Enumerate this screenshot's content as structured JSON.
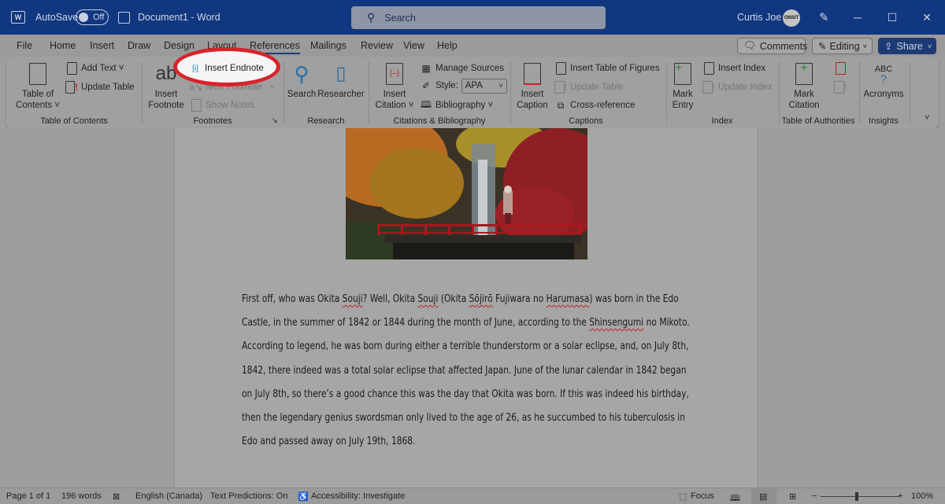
{
  "titlebar": {
    "app_icon": "word-icon",
    "autosave_label": "AutoSave",
    "autosave_state": "Off",
    "doc_title": "Document1  -  Word",
    "search_placeholder": "Search",
    "user_name": "Curtis Joe",
    "avatar_text": "ONSIT",
    "minimize": "─",
    "maximize": "☐",
    "close": "✕"
  },
  "tabs": [
    "File",
    "Home",
    "Insert",
    "Draw",
    "Design",
    "Layout",
    "References",
    "Mailings",
    "Review",
    "View",
    "Help"
  ],
  "active_tab": "References",
  "top_buttons": {
    "comments": "Comments",
    "editing": "Editing",
    "share": "Share"
  },
  "ribbon": {
    "toc": {
      "table_of_contents": [
        "Table of",
        "Contents ˅"
      ],
      "add_text": "Add Text ˅",
      "update_table": "Update Table",
      "label": "Table of Contents"
    },
    "footnotes": {
      "insert_footnote": [
        "Insert",
        "Footnote"
      ],
      "insert_endnote": "Insert Endnote",
      "next_footnote": "Next Footnote",
      "show_notes": "Show Notes",
      "label": "Footnotes"
    },
    "research": {
      "search": "Search",
      "researcher": "Researcher",
      "label": "Research"
    },
    "citations": {
      "insert_citation": [
        "Insert",
        "Citation ˅"
      ],
      "manage_sources": "Manage Sources",
      "style_label": "Style:",
      "style_value": "APA",
      "bibliography": "Bibliography ˅",
      "label": "Citations & Bibliography"
    },
    "captions": {
      "insert_caption": [
        "Insert",
        "Caption"
      ],
      "insert_table_of_figures": "Insert Table of Figures",
      "update_table": "Update Table",
      "cross_reference": "Cross-reference",
      "label": "Captions"
    },
    "index": {
      "mark_entry": [
        "Mark",
        "Entry"
      ],
      "insert_index": "Insert Index",
      "update_index": "Update Index",
      "label": "Index"
    },
    "authorities": {
      "mark_citation": [
        "Mark",
        "Citation"
      ],
      "label": "Table of Authorities"
    },
    "insights": {
      "acronyms_icon_text": "ABC",
      "acronyms": "Acronyms",
      "label": "Insights"
    }
  },
  "document": {
    "image_alt": "Red bridge in front of a waterfall with autumn foliage and a person standing",
    "paragraph": [
      {
        "t": "First off, who was Okita "
      },
      {
        "t": "Souji",
        "s": true
      },
      {
        "t": "? Well, Okita "
      },
      {
        "t": "Souji",
        "s": true
      },
      {
        "t": " (Okita "
      },
      {
        "t": "Sōjirō",
        "s": true
      },
      {
        "t": " Fujiwara no "
      },
      {
        "t": "Harumasa",
        "s": true
      },
      {
        "t": ") was born in the Edo Castle, in the summer of 1842 or 1844 during the month of June, according to the "
      },
      {
        "t": "Shinsengumi",
        "s": true
      },
      {
        "t": " no Mikoto. According to legend, he was born during either a terrible thunderstorm or a solar eclipse, and, on July 8th, 1842, there indeed was a total solar eclipse that affected Japan. June of the lunar calendar in 1842 began on July 8th, so there’s a good chance this was the day that Okita was born. If this was indeed his birthday, then the legendary genius swordsman only lived to the age of 26, as he succumbed to his tuberculosis in Edo and passed away on July 19th, 1868."
      }
    ]
  },
  "statusbar": {
    "page": "Page 1 of 1",
    "words": "196 words",
    "language": "English (Canada)",
    "text_predictions": "Text Predictions: On",
    "accessibility": "Accessibility: Investigate",
    "focus": "Focus",
    "zoom_minus": "−",
    "zoom_plus": "+",
    "zoom_level": "100%",
    "zoom_percent": 100
  },
  "colors": {
    "titlebar": "#10377f",
    "highlight_circle": "#d8232a",
    "share": "#1e3a74"
  }
}
